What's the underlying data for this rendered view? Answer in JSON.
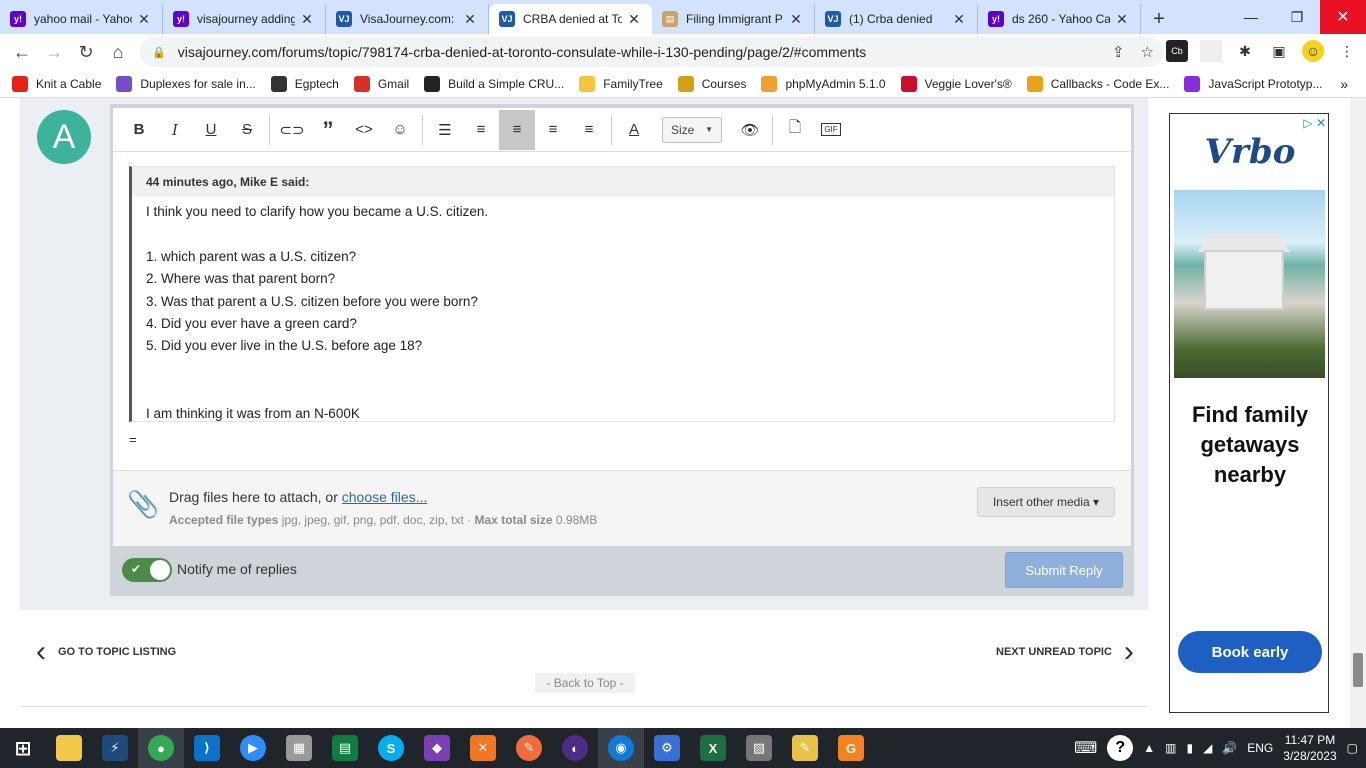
{
  "tabs": [
    {
      "label": "yahoo mail - Yahoo",
      "icon": "yahoo-icon",
      "color": "#6001d2"
    },
    {
      "label": "visajourney adding",
      "icon": "yahoo-icon",
      "color": "#6001d2"
    },
    {
      "label": "VisaJourney.com: S",
      "icon": "visajourney-icon",
      "color": "#1e5aa8"
    },
    {
      "label": "CRBA denied at To",
      "icon": "visajourney-icon",
      "color": "#1e5aa8"
    },
    {
      "label": "Filing Immigrant P",
      "icon": "document-icon",
      "color": "#c9a46a"
    },
    {
      "label": "(1) Crba denied",
      "icon": "visajourney-icon",
      "color": "#1e5aa8"
    },
    {
      "label": "ds 260 - Yahoo Ca",
      "icon": "yahoo-icon",
      "color": "#6001d2"
    }
  ],
  "address": {
    "url": "visajourney.com/forums/topic/798174-crba-denied-at-toronto-consulate-while-i-130-pending/page/2/#comments"
  },
  "bookmarks": [
    {
      "label": "Knit a Cable",
      "color": "#e62117"
    },
    {
      "label": "Duplexes for sale in...",
      "color": "#7a4bc9"
    },
    {
      "label": "Egptech",
      "color": "#333333"
    },
    {
      "label": "Gmail",
      "color": "#d93025"
    },
    {
      "label": "Build a Simple CRU...",
      "color": "#222222"
    },
    {
      "label": "FamilyTree",
      "color": "#f5c542"
    },
    {
      "label": "Courses",
      "color": "#d4a017"
    },
    {
      "label": "phpMyAdmin 5.1.0",
      "color": "#f0a030"
    },
    {
      "label": "Veggie Lover's®",
      "color": "#c8102e"
    },
    {
      "label": "Callbacks - Code Ex...",
      "color": "#e8a317"
    },
    {
      "label": "JavaScript Prototyp...",
      "color": "#8a2be2"
    }
  ],
  "editor": {
    "avatar_letter": "A",
    "size_label": "Size",
    "quote_header": "44 minutes ago, Mike E said:",
    "quote_lines": [
      "I think you need to clarify how you became a U.S. citizen.",
      "",
      "1. which parent was a U.S. citizen?",
      "2. Where was that parent born?",
      "3. Was that parent a U.S. citizen before you were born?",
      "4. Did you ever have a green card?",
      "5. Did you ever live in the U.S. before age 18?",
      "",
      "",
      "I am thinking it was from an N-600K"
    ],
    "after_quote": "=",
    "drag_text": "Drag files here to attach, or",
    "choose_files": "choose files...",
    "accepted_label": "Accepted file types",
    "accepted_types": "jpg, jpeg, gif, png, pdf, doc, zip, txt",
    "sep": "·",
    "max_size_label": "Max total size",
    "max_size": "0.98MB",
    "insert_media": "Insert other media ▾",
    "notify_label": "Notify me of replies",
    "submit_label": "Submit Reply"
  },
  "nav": {
    "go_to_topic": "GO TO TOPIC LISTING",
    "next_unread": "NEXT UNREAD TOPIC",
    "back_to_top": "- Back to Top -"
  },
  "ad": {
    "logo": "Vrbo",
    "title": "Find family getaways nearby",
    "button": "Book early"
  },
  "taskbar": {
    "time": "11:47 PM",
    "date": "3/28/2023",
    "lang": "ENG"
  }
}
